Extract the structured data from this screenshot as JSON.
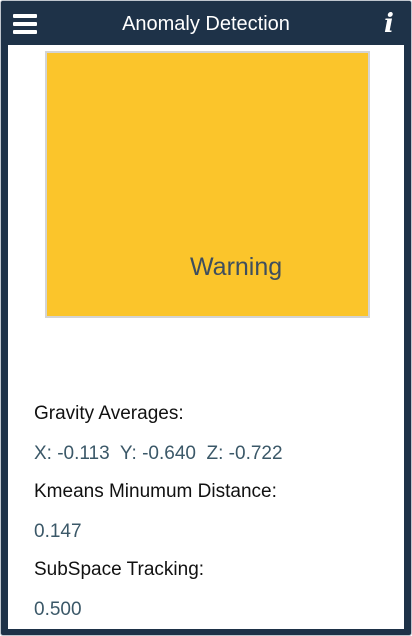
{
  "app_bar": {
    "title": "Anomaly Detection",
    "menu_icon": "hamburger-menu-icon",
    "info_icon": "info-icon",
    "info_glyph": "i",
    "background": "#1e3248"
  },
  "status": {
    "text": "Warning",
    "color": "#fbc52b"
  },
  "gravity": {
    "label": "Gravity Averages:",
    "value": "X: -0.113  Y: -0.640  Z: -0.722"
  },
  "kmeans": {
    "label": "Kmeans Minumum Distance:",
    "value": "0.147"
  },
  "subspace": {
    "label": "SubSpace Tracking:",
    "value": "0.500"
  }
}
